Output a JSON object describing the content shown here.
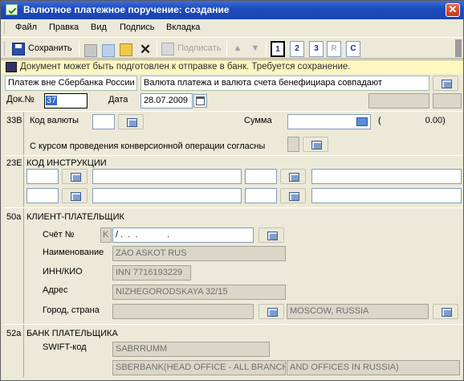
{
  "window": {
    "title": "Валютное платежное поручение: создание",
    "close": "✕"
  },
  "menu": [
    "Файл",
    "Правка",
    "Вид",
    "Подпись",
    "Вкладка"
  ],
  "toolbar": {
    "save_label": "Сохранить",
    "sign_label": "Подписать",
    "pages": [
      "1",
      "2",
      "3",
      "R",
      "C"
    ]
  },
  "info": {
    "message": "Документ может быть подготовлен к отправке в банк. Требуется сохранение."
  },
  "header": {
    "payment_type": "Платеж вне Сбербанка России",
    "currency_note": "Валюта платежа и валюта счета бенефициара совпадают",
    "doc_no_label": "Док.№",
    "doc_no": "37",
    "date_label": "Дата",
    "date": "28.07.2009"
  },
  "f33b": {
    "code": "33B",
    "currency_label": "Код валюты",
    "amount_label": "Сумма",
    "amount_display": "(                  0.00)",
    "conv_label": "С курсом проведения конверсионной операции согласны"
  },
  "f23e": {
    "code": "23E",
    "title": "КОД ИНСТРУКЦИИ"
  },
  "f50a": {
    "code": "50a",
    "title": "КЛИЕНТ-ПЛАТЕЛЬЩИК",
    "account_label": "Счёт №",
    "account_prefix": "K",
    "account_value": "/ .  .  .            .",
    "name_label": "Наименование",
    "name": "ZAO ASKOT RUS",
    "inn_label": "ИНН/КИО",
    "inn": "INN 7716193229",
    "address_label": "Адрес",
    "address": "NIZHEGORODSKAYA 32/15",
    "city_label": "Город, страна",
    "city_country": "MOSCOW, RUSSIA"
  },
  "f52a": {
    "code": "52a",
    "title": "БАНК ПЛАТЕЛЬЩИКА",
    "swift_label": "SWIFT-код",
    "swift": "SABRRUMM",
    "bank_name_1": "SBERBANK(HEAD OFFICE - ALL BRANCHES",
    "bank_name_2": "AND OFFICES IN RUSSIA)"
  }
}
